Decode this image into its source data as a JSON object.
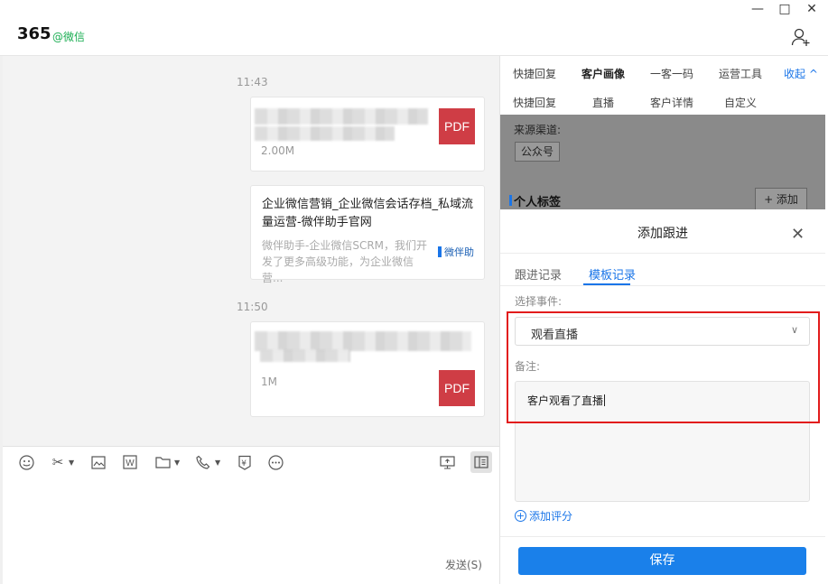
{
  "window": {
    "controls": [
      "—",
      "□",
      "✕"
    ]
  },
  "header": {
    "title": "365",
    "tag": "@微信",
    "add_member_icon": "add-user-icon"
  },
  "chat": {
    "messages": [
      {
        "time": "11:43",
        "type": "file",
        "file_icon": "PDF",
        "size": "2.00M"
      },
      {
        "type": "link",
        "title": "企业微信营销_企业微信会话存档_私域流量运营-微伴助手官网",
        "desc": "微伴助手-企业微信SCRM，我们开发了更多高级功能，为企业微信营...",
        "source": "微伴助"
      },
      {
        "time": "11:50",
        "type": "file",
        "file_icon": "PDF",
        "size": "1M"
      }
    ]
  },
  "toolbar": {
    "icons": [
      "emoji-icon",
      "scissors-icon",
      "image-icon",
      "word-doc-icon",
      "folder-icon",
      "phone-icon",
      "red-packet-icon",
      "more-icon",
      "screen-share-icon",
      "sidebar-toggle-icon"
    ],
    "send_label": "发送(S)"
  },
  "sidebar": {
    "tabs_row1": [
      "快捷回复",
      "客户画像",
      "一客一码",
      "运营工具"
    ],
    "collapse_label": "收起 ^",
    "tabs_row2": [
      "快捷回复",
      "直播",
      "客户详情",
      "自定义"
    ],
    "source_label": "来源渠道:",
    "source_value": "公众号",
    "personal_tags": "个人标签",
    "add_tag_label": "+ 添加"
  },
  "modal": {
    "title": "添加跟进",
    "tabs": [
      "跟进记录",
      "模板记录"
    ],
    "active_tab": 1,
    "event_label": "选择事件:",
    "event_value": "观看直播",
    "note_label": "备注:",
    "note_value": "客户观看了直播",
    "add_score_label": "添加评分",
    "save_label": "保存"
  },
  "colors": {
    "accent": "#1a75e8",
    "highlight": "#e21b1b",
    "pdf": "#cf3d45",
    "tag_green": "#1aad52"
  }
}
